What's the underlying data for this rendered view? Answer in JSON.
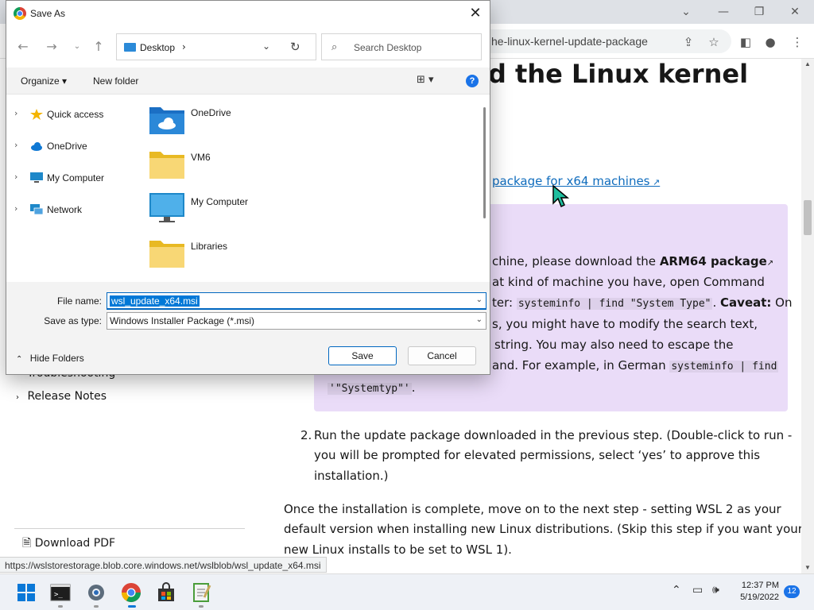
{
  "browser": {
    "url_fragment": "he-linux-kernel-update-package",
    "heading_fragment": "d the Linux kernel",
    "link_text": "package for x64 machines",
    "note": {
      "l1_a": "chine, please download the ",
      "l1_b": "ARM64 package",
      "l2": "at kind of machine you have, open Command",
      "l3_a": "ter: ",
      "l3_code": "systeminfo | find \"System Type\"",
      "l3_b": ". ",
      "l3_c": "Caveat:",
      "l3_d": " On",
      "l4": "s, you might have to modify the search text,",
      "l5": "string. You may also need to escape the",
      "l6_a": "and. For example, in German ",
      "l6_code": "systeminfo | find",
      "l7_code": "'\"Systemtyp\"'",
      "l7_b": "."
    },
    "step2_num": "2.",
    "step2_l1": "Run the update package downloaded in the previous step. (Double-click to run -",
    "step2_l2": "you will be prompted for elevated permissions, select ‘yes’ to approve this",
    "step2_l3": "installation.)",
    "para_l1": "Once the installation is complete, move on to the next step - setting WSL 2 as your",
    "para_l2": "default version when installing new Linux distributions. (Skip this step if you want your",
    "para_l3": "new Linux installs to be set to WSL 1).",
    "left_nav": {
      "troubleshooting": "Troubleshooting",
      "release_notes": "Release Notes",
      "download_pdf": "Download PDF"
    },
    "status_url": "https://wslstorestorage.blob.core.windows.net/wslblob/wsl_update_x64.msi"
  },
  "dialog": {
    "title": "Save As",
    "address": "Desktop",
    "search_placeholder": "Search Desktop",
    "organize": "Organize ▾",
    "new_folder": "New folder",
    "tree": [
      {
        "label": "Quick access",
        "icon": "star-icon"
      },
      {
        "label": "OneDrive",
        "icon": "cloud-icon"
      },
      {
        "label": "My Computer",
        "icon": "computer-icon"
      },
      {
        "label": "Network",
        "icon": "network-icon"
      }
    ],
    "files": [
      {
        "label": "OneDrive",
        "icon": "onedrive-folder-icon"
      },
      {
        "label": "VM6",
        "icon": "folder-icon"
      },
      {
        "label": "My Computer",
        "icon": "monitor-icon"
      },
      {
        "label": "Libraries",
        "icon": "folder-icon"
      }
    ],
    "file_name_label": "File name:",
    "file_name_value": "wsl_update_x64.msi",
    "save_as_type_label": "Save as type:",
    "save_as_type_value": "Windows Installer Package (*.msi)",
    "hide_folders": "Hide Folders",
    "save": "Save",
    "cancel": "Cancel"
  },
  "taskbar": {
    "time": "12:37 PM",
    "date": "5/19/2022",
    "notifications": "12"
  },
  "colors": {
    "accent": "#0067c0",
    "note_bg": "#eadcf8",
    "link": "#0f6cbd"
  }
}
